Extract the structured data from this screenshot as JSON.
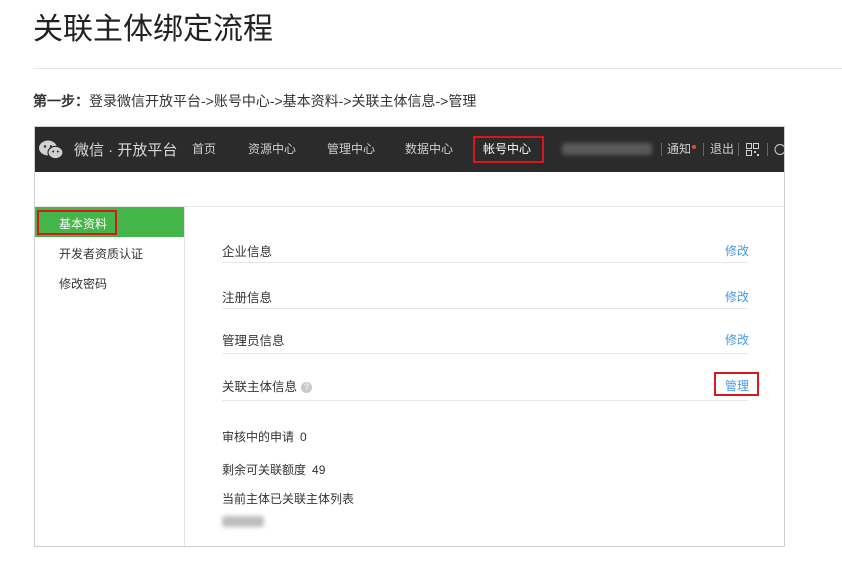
{
  "page": {
    "title": "关联主体绑定流程",
    "step_prefix": "第一步：",
    "step_text": "登录微信开放平台->账号中心->基本资料->关联主体信息->管理"
  },
  "topbar": {
    "brand": "微信 · 开放平台",
    "nav": [
      "首页",
      "资源中心",
      "管理中心",
      "数据中心",
      "帐号中心"
    ],
    "notify": "通知",
    "logout": "退出"
  },
  "sidebar": {
    "items": [
      "基本资料",
      "开发者资质认证",
      "修改密码"
    ]
  },
  "content": {
    "rows": [
      {
        "label": "企业信息",
        "action": "修改"
      },
      {
        "label": "注册信息",
        "action": "修改"
      },
      {
        "label": "管理员信息",
        "action": "修改"
      },
      {
        "label": "关联主体信息",
        "action": "管理",
        "help": "?"
      }
    ],
    "pending_label": "审核中的申请",
    "pending_value": "0",
    "remaining_label": "剩余可关联额度",
    "remaining_value": "49",
    "list_label": "当前主体已关联主体列表"
  },
  "colors": {
    "topbar_bg": "#2b2b2b",
    "sidebar_active": "#44b549",
    "link": "#459ae9",
    "highlight": "#d9161b"
  }
}
